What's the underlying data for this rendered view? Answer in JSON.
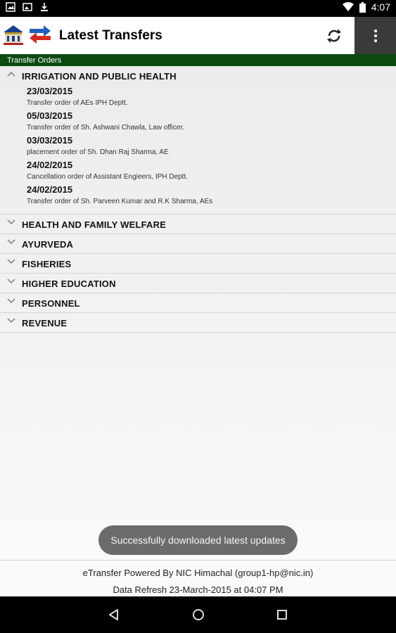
{
  "status_bar": {
    "time": "4:07",
    "left_icons": [
      "image-icon",
      "photo-icon",
      "download-icon"
    ],
    "right_icons": [
      "wifi-icon",
      "battery-icon"
    ]
  },
  "app_bar": {
    "title": "Latest Transfers",
    "logo_icon": "himachal-emblem-icon",
    "transfer_icon": "transfer-arrows-icon",
    "refresh_icon": "refresh-icon",
    "menu_icon": "overflow-menu-icon"
  },
  "section_label": "Transfer Orders",
  "departments": [
    {
      "name": "IRRIGATION AND PUBLIC HEALTH",
      "expanded": true,
      "orders": [
        {
          "date": "23/03/2015",
          "desc": "Transfer order of AEs IPH Deptt."
        },
        {
          "date": "05/03/2015",
          "desc": "Transfer order of Sh. Ashwani Chawla, Law officer."
        },
        {
          "date": "03/03/2015",
          "desc": "placement order of Sh. Dhan Raj Sharma, AE"
        },
        {
          "date": "24/02/2015",
          "desc": "Cancellation order of Assistant Engieers, IPH Deptt."
        },
        {
          "date": "24/02/2015",
          "desc": "Transfer order of Sh. Parveen Kumar and R.K Sharma, AEs"
        }
      ]
    },
    {
      "name": "HEALTH AND FAMILY WELFARE",
      "expanded": false
    },
    {
      "name": "AYURVEDA",
      "expanded": false
    },
    {
      "name": "FISHERIES",
      "expanded": false
    },
    {
      "name": "HIGHER EDUCATION",
      "expanded": false
    },
    {
      "name": "PERSONNEL",
      "expanded": false
    },
    {
      "name": "REVENUE",
      "expanded": false
    }
  ],
  "toast": "Successfully downloaded latest updates",
  "footer": {
    "line1": "eTransfer Powered By NIC Himachal (group1-hp@nic.in)",
    "line2": "Data Refresh 23-March-2015 at 04:07 PM"
  },
  "nav": [
    "back-icon",
    "home-icon",
    "recents-icon"
  ],
  "colors": {
    "section_bar": "#0b4b12",
    "overflow_bg": "#3a3a3a",
    "arrow_red": "#d42a20",
    "arrow_blue": "#1f5fbf"
  }
}
